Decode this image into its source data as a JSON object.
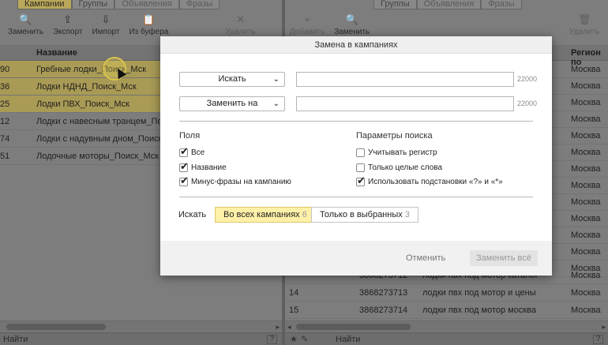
{
  "left_pane": {
    "tabs": [
      {
        "label": "Кампании",
        "active": true
      },
      {
        "label": "Группы",
        "active": false
      },
      {
        "label": "Объявления",
        "active": false
      },
      {
        "label": "Фразы",
        "active": false
      }
    ],
    "toolbar": [
      {
        "icon": "search-icon",
        "glyph": "🔍",
        "label": "Заменить"
      },
      {
        "icon": "export-icon",
        "glyph": "⇪",
        "label": "Экспорт"
      },
      {
        "icon": "import-icon",
        "glyph": "⇩",
        "label": "Импорт"
      },
      {
        "icon": "clipboard-icon",
        "glyph": "📋",
        "label": "Из буфера"
      },
      {
        "icon": "delete-icon",
        "glyph": "✕",
        "label": "Удалить"
      }
    ],
    "column_header": "Название",
    "rows": [
      {
        "id": "90",
        "name": "Гребные лодки_Поиск_Мск",
        "selected": true
      },
      {
        "id": "36",
        "name": "Лодки НДНД_Поиск_Мск",
        "selected": true
      },
      {
        "id": "25",
        "name": "Лодки ПВХ_Поиск_Мск",
        "selected": true
      },
      {
        "id": "12",
        "name": "Лодки с навесным транцем_Поиск_Мск",
        "selected": false
      },
      {
        "id": "74",
        "name": "Лодки с надувным дном_Поиск_Мск",
        "selected": false
      },
      {
        "id": "51",
        "name": "Лодочные моторы_Поиск_Мск",
        "selected": false
      }
    ],
    "status_find": "Найти",
    "help": "?"
  },
  "right_pane": {
    "tabs": [
      {
        "label": "Группы",
        "active": false
      },
      {
        "label": "Объявления",
        "active": false
      },
      {
        "label": "Фразы",
        "active": false
      }
    ],
    "toolbar": [
      {
        "icon": "add-icon",
        "glyph": "+",
        "label": "Добавить",
        "disabled": true
      },
      {
        "icon": "search-icon",
        "glyph": "🔍",
        "label": "Заменить",
        "disabled": false
      },
      {
        "icon": "delete-icon",
        "glyph": "🗑",
        "label": "Удалить",
        "disabled": true
      }
    ],
    "column_header": "Регион по",
    "region_rows": [
      "Москва",
      "Москва",
      "Москва",
      "Москва",
      "Москва",
      "Москва",
      "Москва",
      "Москва",
      "Москва",
      "Москва",
      "Москва",
      "Москва",
      "Москва"
    ],
    "bottom_rows": [
      {
        "num": "",
        "id": "3868273712",
        "name": "лодки пвх под мотор каталог",
        "region": "Москва"
      },
      {
        "num": "14",
        "id": "3868273713",
        "name": "лодки пвх под мотор и цены",
        "region": "Москва"
      },
      {
        "num": "15",
        "id": "3868273714",
        "name": "лодки пвх под мотор москва",
        "region": "Москва"
      }
    ],
    "status_find": "Найти",
    "help": "?"
  },
  "modal": {
    "title": "Замена в кампаниях",
    "search_mode": "Искать",
    "search_value": "",
    "search_limit": "22000",
    "replace_mode": "Заменить на",
    "replace_value": "",
    "replace_limit": "22000",
    "fields_title": "Поля",
    "fields": [
      {
        "label": "Все",
        "checked": true
      },
      {
        "label": "Название",
        "checked": true
      },
      {
        "label": "Минус-фразы на кампанию",
        "checked": true
      }
    ],
    "params_title": "Параметры поиска",
    "params": [
      {
        "label": "Учитывать регистр",
        "checked": false
      },
      {
        "label": "Только целые слова",
        "checked": false
      },
      {
        "label": "Использовать подстановки «?» и «*»",
        "checked": true
      }
    ],
    "scope_label": "Искать",
    "scope_all": {
      "label": "Во всех кампаниях",
      "count": "6"
    },
    "scope_selected": {
      "label": "Только в выбранных",
      "count": "3"
    },
    "cancel_label": "Отменить",
    "replace_all_label": "Заменить всё"
  }
}
